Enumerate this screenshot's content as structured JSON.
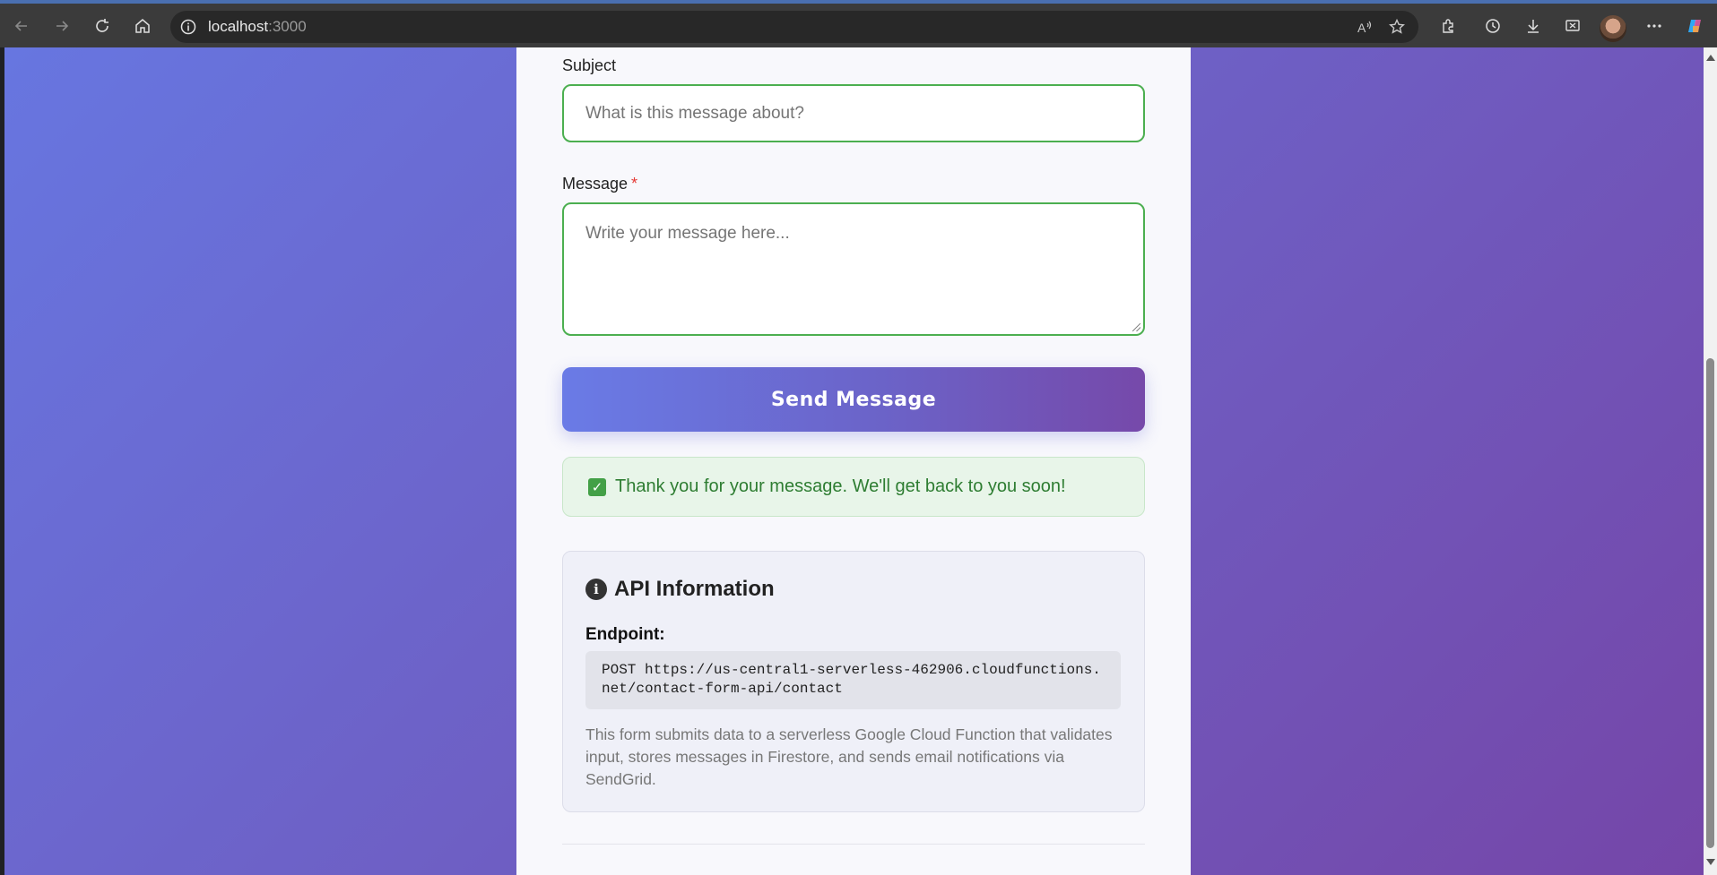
{
  "browser": {
    "url_host": "localhost",
    "url_port": ":3000"
  },
  "form": {
    "subject_label": "Subject",
    "subject_placeholder": "What is this message about?",
    "message_label": "Message",
    "message_required": "*",
    "message_placeholder": "Write your message here...",
    "send_label": "Send Message"
  },
  "success": {
    "icon": "check-mark",
    "text": "Thank you for your message. We'll get back to you soon!"
  },
  "api_info": {
    "title": "API Information",
    "endpoint_label": "Endpoint:",
    "endpoint_value": "POST https://us-central1-serverless-462906.cloudfunctions.net/contact-form-api/contact",
    "description": "This form submits data to a serverless Google Cloud Function that validates input, stores messages in Firestore, and sends email notifications via SendGrid."
  },
  "colors": {
    "accent_start": "#6a7be6",
    "accent_end": "#7649aa",
    "valid_border": "#4caf50",
    "success_bg": "#e8f5e9",
    "success_text": "#2e7d32"
  }
}
